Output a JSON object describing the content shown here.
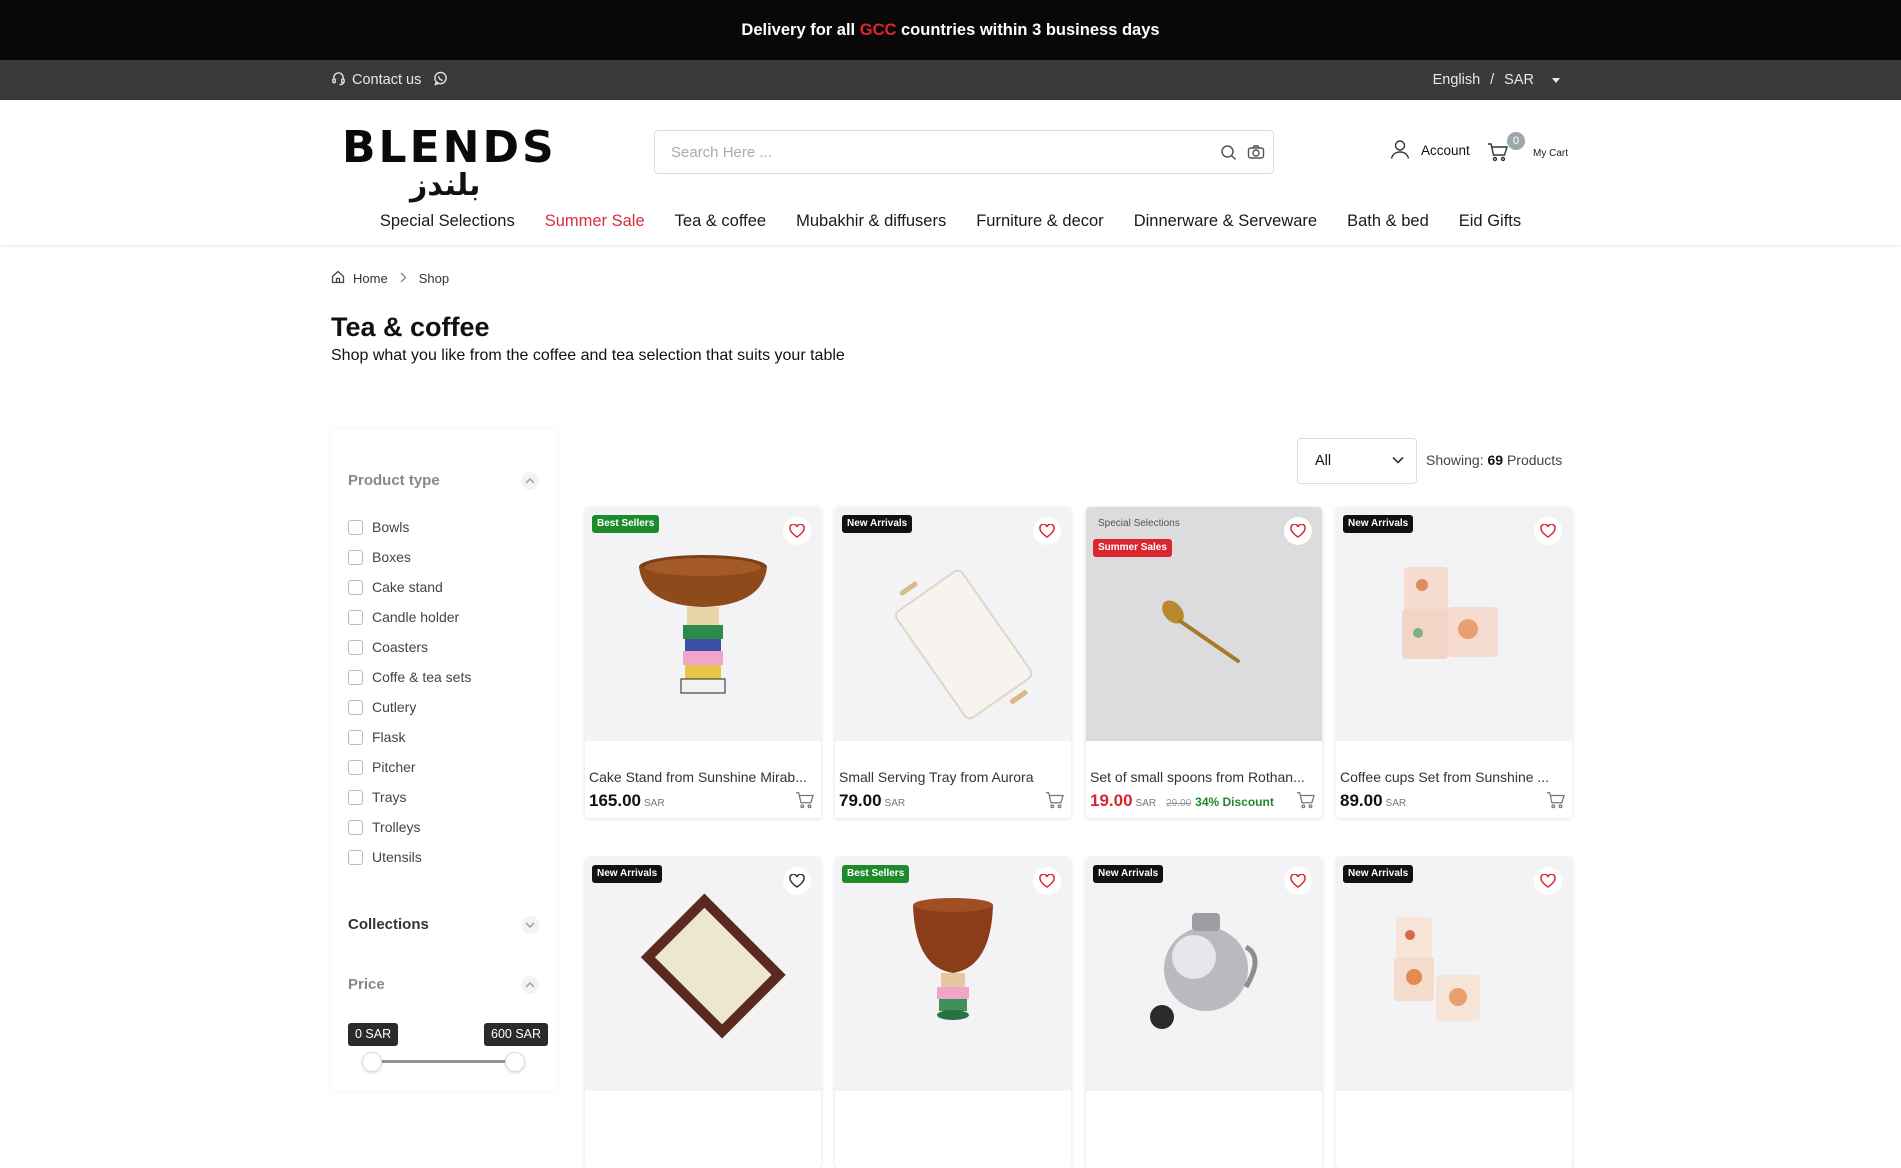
{
  "announcement": {
    "before": "Delivery for all ",
    "highlight": "GCC",
    "after": " countries within 3 business days"
  },
  "utility": {
    "contact": "Contact us",
    "language": "English",
    "separator": "/",
    "currency": "SAR"
  },
  "header": {
    "logo_text": "BLENDS",
    "logo_arabic": "بلندز",
    "search_placeholder": "Search Here ...",
    "account": "Account",
    "cart_count": "0",
    "cart_label": "My Cart"
  },
  "nav": [
    "Special Selections",
    "Summer Sale",
    "Tea & coffee",
    "Mubakhir & diffusers",
    "Furniture & decor",
    "Dinnerware & Serveware",
    "Bath & bed",
    "Eid Gifts"
  ],
  "breadcrumb": {
    "home": "Home",
    "current": "Shop"
  },
  "page": {
    "title": "Tea & coffee",
    "subtitle": "Shop what you like from the coffee and tea selection that suits your table"
  },
  "filters": {
    "product_type_title": "Product type",
    "product_types": [
      "Bowls",
      "Boxes",
      "Cake stand",
      "Candle holder",
      "Coasters",
      "Coffe & tea sets",
      "Cutlery",
      "Flask",
      "Pitcher",
      "Trays",
      "Trolleys",
      "Utensils"
    ],
    "collections_title": "Collections",
    "price_title": "Price",
    "price_min": "0 SAR",
    "price_max": "600 SAR"
  },
  "toolbar": {
    "sort_value": "All",
    "showing_label": "Showing:",
    "count": "69",
    "products_label": "Products"
  },
  "products": [
    {
      "badge": "Best Sellers",
      "name": "Cake Stand from Sunshine Mirab...",
      "price": "165.00",
      "currency": "SAR"
    },
    {
      "badge": "New Arrivals",
      "name": "Small Serving Tray from Aurora",
      "price": "79.00",
      "currency": "SAR"
    },
    {
      "badge": "Special Selections",
      "badge2": "Summer Sales",
      "name": "Set of small spoons from Rothan...",
      "price": "19.00",
      "currency": "SAR",
      "old_price": "29.00",
      "discount": "34% Discount"
    },
    {
      "badge": "New Arrivals",
      "name": "Coffee cups Set from Sunshine ...",
      "price": "89.00",
      "currency": "SAR"
    },
    {
      "badge": "New Arrivals"
    },
    {
      "badge": "Best Sellers"
    },
    {
      "badge": "New Arrivals"
    },
    {
      "badge": "New Arrivals"
    }
  ],
  "colors": {
    "accent_red": "#d9262f",
    "best_green": "#1d8a2b",
    "dark_bar": "#080808",
    "utility_bar": "#3a3a3a"
  }
}
